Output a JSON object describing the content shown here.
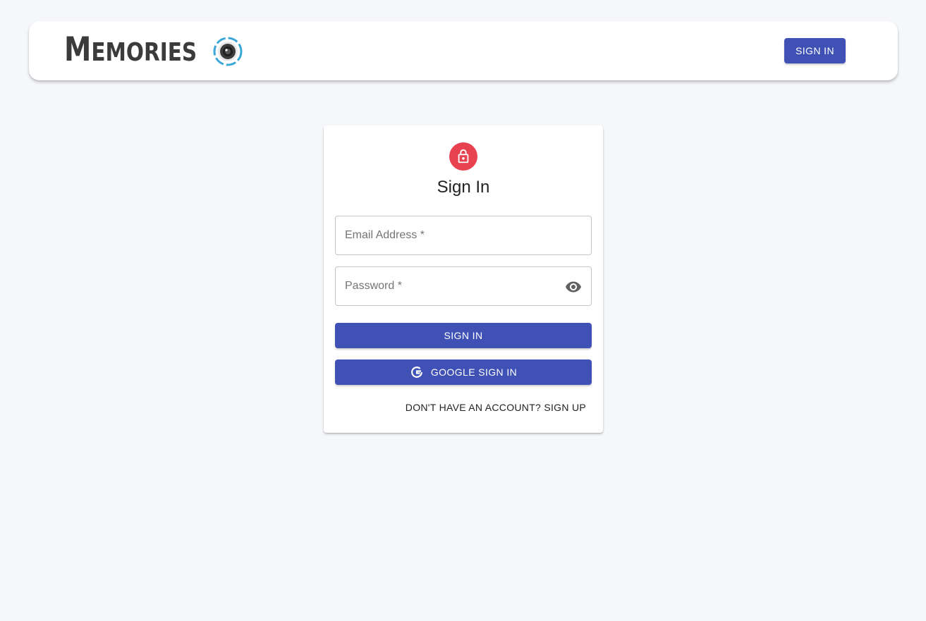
{
  "header": {
    "brand_first": "M",
    "brand_rest": "EMORIES",
    "signin_label": "SIGN IN"
  },
  "card": {
    "title": "Sign In",
    "email_label": "Email Address *",
    "password_label": "Password *",
    "signin_label": "SIGN IN",
    "google_label": "GOOGLE SIGN IN",
    "switch_label": "DON'T HAVE AN ACCOUNT? SIGN UP"
  },
  "icons": {
    "logo": "camera-lens-icon",
    "lock": "lock-icon",
    "eye": "visibility-icon",
    "google": "google-icon"
  },
  "colors": {
    "primary": "#3f51b5",
    "avatar": "#e8414f",
    "background": "#f6f7fb",
    "logo_ring": "#3aa7d9"
  }
}
